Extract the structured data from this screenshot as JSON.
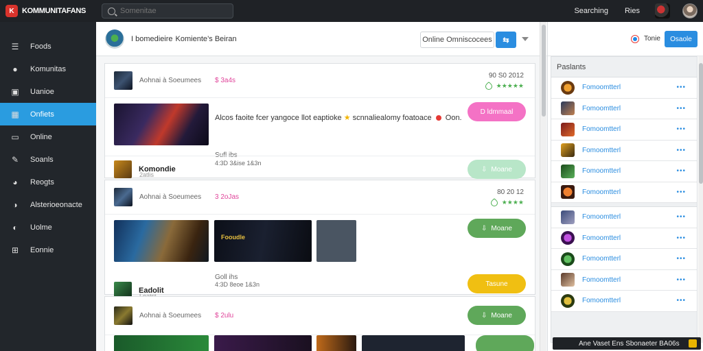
{
  "app": {
    "logo_badge": "K",
    "logo_text": "KOMMUNITAFANS"
  },
  "search": {
    "placeholder": "Somenitae"
  },
  "topbar": {
    "link1": "Searching",
    "link2": "Ries"
  },
  "sidebar": {
    "items": [
      {
        "label": "Foods",
        "icon": "list-icon"
      },
      {
        "label": "Komunitas",
        "icon": "chat-icon"
      },
      {
        "label": "Uanioe",
        "icon": "folder-icon"
      },
      {
        "label": "Onfiets",
        "icon": "grid-icon",
        "active": true
      },
      {
        "label": "Online",
        "icon": "inbox-icon"
      },
      {
        "label": "Soanls",
        "icon": "pen-icon"
      },
      {
        "label": "Reogts",
        "icon": "report-icon"
      },
      {
        "label": "Alsterioeonacte",
        "icon": "settings-icon"
      },
      {
        "label": "Uolme",
        "icon": "user-icon"
      },
      {
        "label": "Eonnie",
        "icon": "table-icon"
      }
    ]
  },
  "main": {
    "title_a": "I bomedieire",
    "title_b": "Komiente’s Beiran",
    "select_label": "Online Omniscocees",
    "btn_label": "⇆"
  },
  "cards": [
    {
      "name": "Aohnai à Soeumees",
      "price": "$ 3a4s",
      "code": "90 S0 2012",
      "rating": "★★★★★",
      "caption": "Alcos faoite fcer yangoce llot eaptioke",
      "caption2": "scnnaliealomy foatoace",
      "caption3": "Oon.",
      "pill": "D ldmmaal",
      "pill_color": "#f472c5",
      "sub": "Sufl ibs",
      "foot_name": "Komondie",
      "foot_sub": "2atlis",
      "foot_meta": "4:3D 3&ise 1&3n",
      "foot_pill": "Moane",
      "foot_pill_color": "#b8e6c8"
    },
    {
      "name": "Aohnai à Soeumees",
      "price": "3 2oJas",
      "code": "80 20 12",
      "rating": "★★★★",
      "media_label": "Fooudle",
      "pill": "Moane",
      "pill_color": "#5fa85a",
      "sub": "Goll ihs",
      "foot_name": "Eadolit",
      "foot_sub": "Loatst",
      "foot_meta": "4:3D 8eoe 1&3n",
      "foot_pill": "Tasune",
      "foot_pill_color": "#f0bf12"
    },
    {
      "name": "Aohnai à Soeumees",
      "price": "$ 2ulu",
      "pill": "Moane",
      "pill_color": "#5fa85a"
    }
  ],
  "rpanel": {
    "label": "Tonie",
    "btn": "Osaole",
    "title": "Paslants",
    "items_a": [
      "Fomoomtterl",
      "Fomoomtterl",
      "Fomoomtterl",
      "Fomoomtterl",
      "Fomoomtterl",
      "Fomoomtterl"
    ],
    "items_b": [
      "Fomoomtterl",
      "Fomoomtterl",
      "Fomoomtterl",
      "Fomoomtterl",
      "Fomoomtterl"
    ],
    "dots": "•••"
  },
  "toast": {
    "text": "Ane Vaset Ens Sbonaeter BA06s"
  },
  "colors": {
    "accent": "#2a9ce0",
    "sidebar_bg": "#22262b",
    "topbar_bg": "#1f2226",
    "price": "#e0449a",
    "link": "#2a8de0"
  }
}
